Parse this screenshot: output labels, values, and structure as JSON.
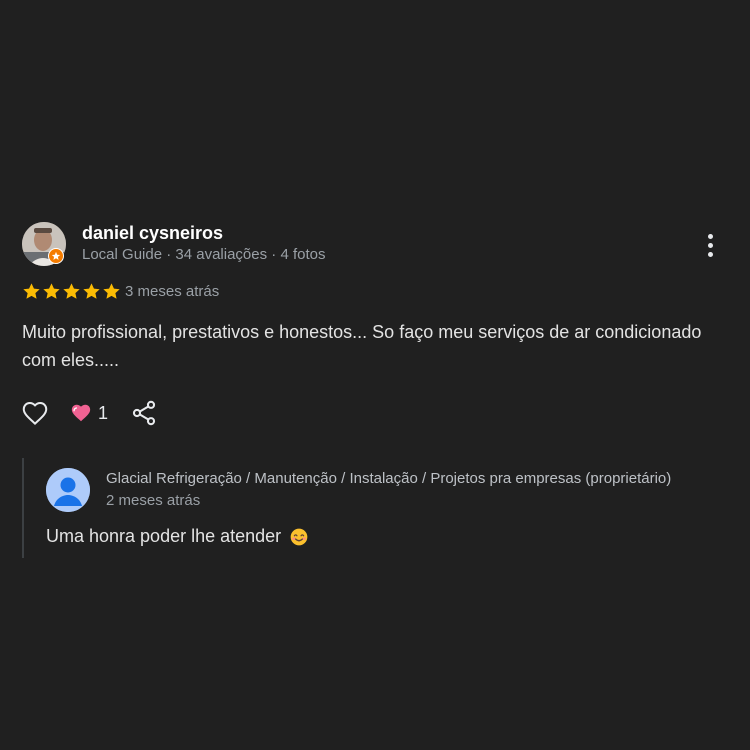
{
  "review": {
    "author_name": "daniel cysneiros",
    "author_meta": "Local Guide · 34 avaliações · 4 fotos",
    "rating": 5,
    "rating_max": 5,
    "time": "3 meses atrás",
    "text": "Muito profissional, prestativos e honestos... So faço meu serviços de ar condicionado com eles.....",
    "reaction_count": "1",
    "colors": {
      "star": "#fbbc04",
      "badge": "#f57c00",
      "heart": "#f06292"
    },
    "icons": [
      "more-vert-icon",
      "heart-outline-icon",
      "heart-reaction-icon",
      "share-icon",
      "local-guide-star-icon"
    ]
  },
  "owner_reply": {
    "owner_name": "Glacial Refrigeração / Manutenção / Instalação / Projetos pra empresas (proprietário)",
    "time": "2 meses atrás",
    "text": "Uma honra poder lhe atender",
    "emoji": "smiling-face-emoji"
  }
}
